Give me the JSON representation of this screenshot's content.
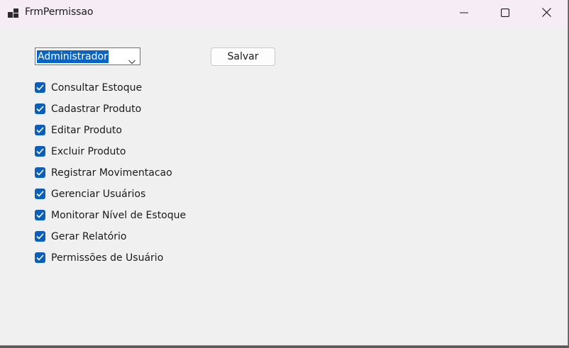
{
  "window": {
    "title": "FrmPermissao",
    "controls": [
      "minimize-icon",
      "maximize-icon",
      "close-icon"
    ]
  },
  "role_select": {
    "value": "Administrador"
  },
  "save_button": {
    "label": "Salvar"
  },
  "permissions": [
    {
      "label": "Consultar Estoque",
      "checked": true
    },
    {
      "label": "Cadastrar Produto",
      "checked": true
    },
    {
      "label": "Editar Produto",
      "checked": true
    },
    {
      "label": "Excluir Produto",
      "checked": true
    },
    {
      "label": "Registrar Movimentacao",
      "checked": true
    },
    {
      "label": "Gerenciar Usuários",
      "checked": true
    },
    {
      "label": "Monitorar Nível de Estoque",
      "checked": true
    },
    {
      "label": "Gerar Relatório",
      "checked": true
    },
    {
      "label": "Permissões de Usuário",
      "checked": true
    }
  ],
  "colors": {
    "accent": "#0a5fba",
    "titlebar": "#f6ecf6",
    "window_bg": "#f0f0f0"
  }
}
